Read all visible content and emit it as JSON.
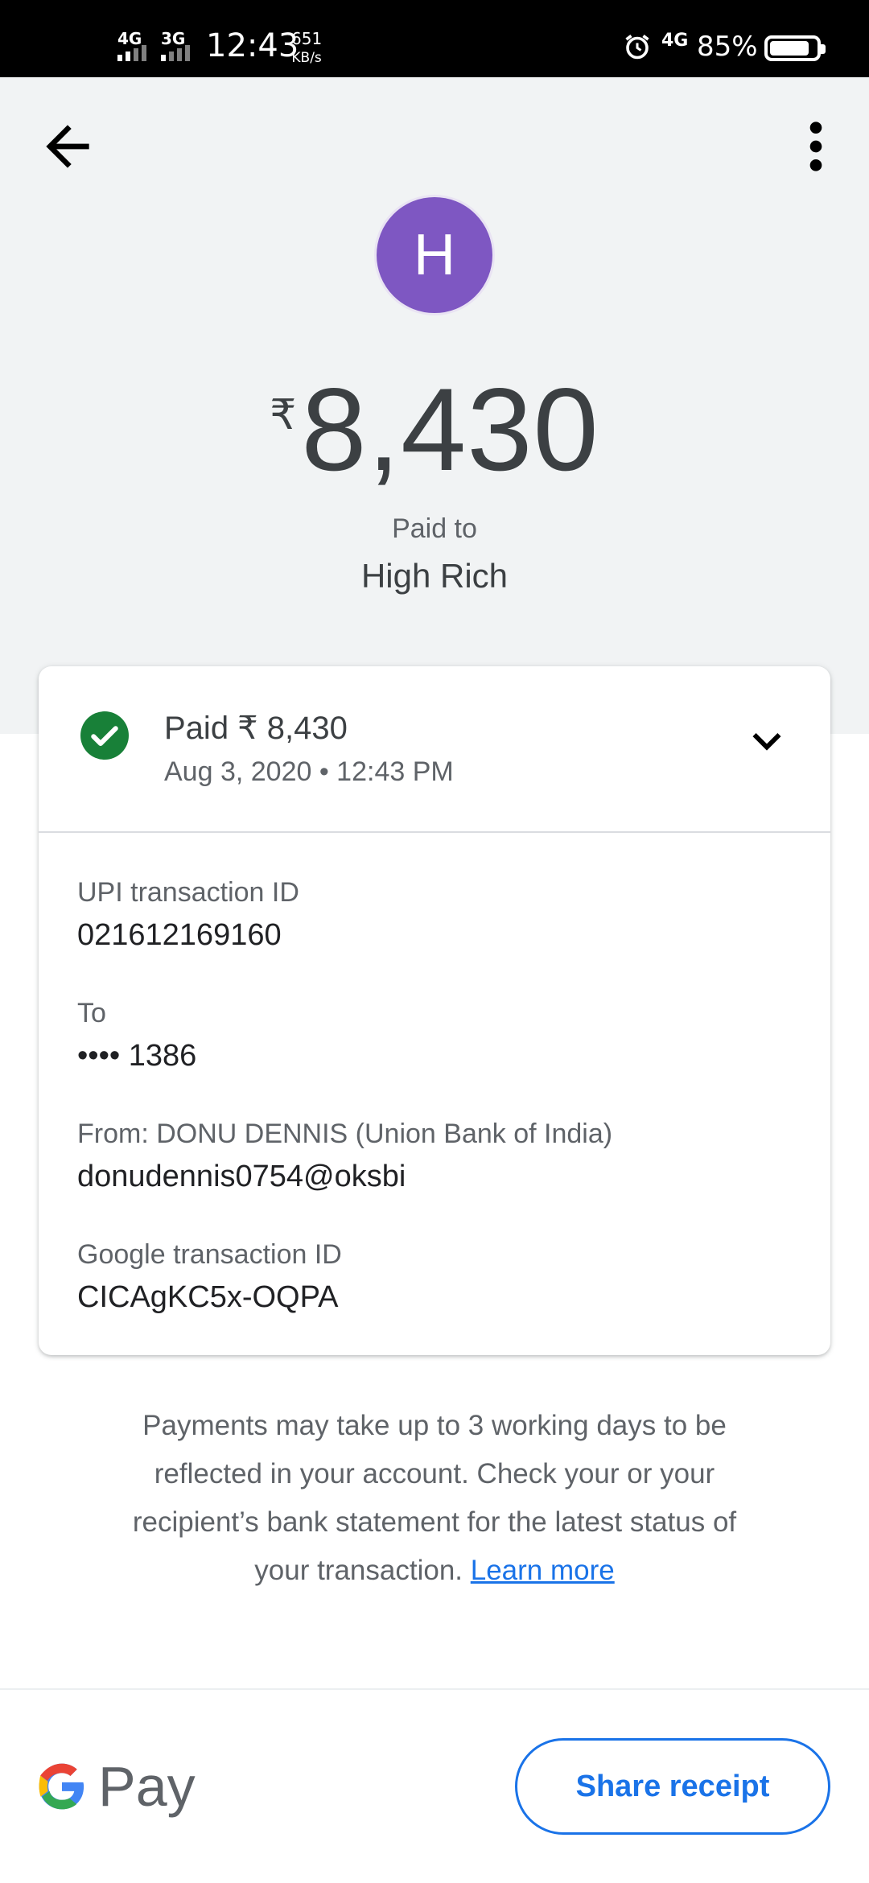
{
  "status_bar": {
    "net1": "4G",
    "net2": "3G",
    "time": "12:43",
    "speed_value": "651",
    "speed_unit": "KB/s",
    "net_right": "4G",
    "battery": "85%",
    "battery_level": 0.85
  },
  "header": {
    "avatar_initial": "H",
    "currency_symbol": "₹",
    "amount": "8,430",
    "paid_to_label": "Paid to",
    "payee_name": "High Rich"
  },
  "card": {
    "summary_title": "Paid ₹ 8,430",
    "summary_date": "Aug 3, 2020 • 12:43 PM",
    "details": [
      {
        "label": "UPI transaction ID",
        "value": "021612169160"
      },
      {
        "label": "To",
        "value": "•••• 1386"
      },
      {
        "label": "From: DONU DENNIS (Union Bank of India)",
        "value": "donudennis0754@oksbi"
      },
      {
        "label": "Google transaction ID",
        "value": "CICAgKC5x-OQPA"
      }
    ]
  },
  "note": {
    "text": "Payments may take up to 3 working days to be reflected in your account. Check your or your recipient’s bank statement for the latest status of your transaction.",
    "link": "Learn more"
  },
  "footer": {
    "brand_text": "Pay",
    "share_label": "Share receipt"
  },
  "colors": {
    "accent": "#1a73e8",
    "avatar": "#7e57c2",
    "success": "#188038",
    "header_bg": "#f1f3f4"
  },
  "icons": [
    "back-arrow-icon",
    "more-vert-icon",
    "check-circle-icon",
    "chevron-down-icon",
    "google-g-icon",
    "alarm-icon"
  ]
}
